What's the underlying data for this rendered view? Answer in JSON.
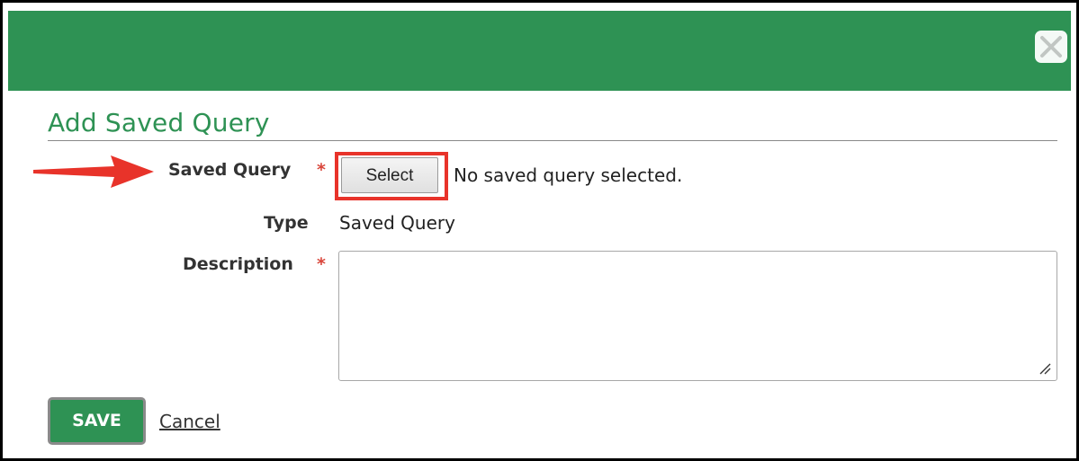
{
  "dialog": {
    "title": "Add Saved Query",
    "accent_color": "#2e9254",
    "highlight_color": "#e8332a"
  },
  "fields": {
    "saved_query": {
      "label": "Saved Query",
      "required_mark": "*",
      "button_label": "Select",
      "status_text": "No saved query selected."
    },
    "type": {
      "label": "Type",
      "value": "Saved Query"
    },
    "description": {
      "label": "Description",
      "required_mark": "*",
      "value": ""
    }
  },
  "actions": {
    "save_label": "SAVE",
    "cancel_label": "Cancel"
  },
  "icons": {
    "close": "close-icon",
    "annotation_arrow": "arrow-right-icon",
    "resize": "resize-grip-icon"
  }
}
